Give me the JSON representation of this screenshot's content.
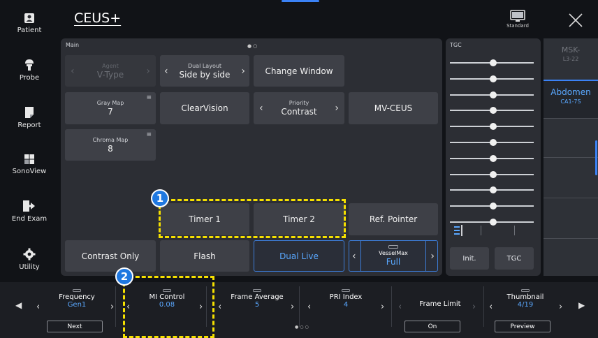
{
  "header": {
    "title": "CEUS+",
    "preset_label": "Standard"
  },
  "sidebar": {
    "items": [
      {
        "label": "Patient",
        "icon": "patient-icon"
      },
      {
        "label": "Probe",
        "icon": "probe-icon"
      },
      {
        "label": "Report",
        "icon": "report-icon"
      },
      {
        "label": "SonoView",
        "icon": "sonoview-icon"
      },
      {
        "label": "End Exam",
        "icon": "end-exam-icon"
      },
      {
        "label": "Utility",
        "icon": "gear-icon"
      }
    ]
  },
  "main": {
    "panel_label": "Main",
    "agent": {
      "small": "Agent",
      "value": "V-Type"
    },
    "dual_layout": {
      "small": "Dual Layout",
      "value": "Side by side"
    },
    "change_window": "Change Window",
    "gray_map": {
      "small": "Gray Map",
      "value": "7"
    },
    "clearvision": "ClearVision",
    "priority": {
      "small": "Priority",
      "value": "Contrast"
    },
    "mv_ceus": "MV-CEUS",
    "chroma_map": {
      "small": "Chroma Map",
      "value": "8"
    },
    "timer1": "Timer 1",
    "timer2": "Timer 2",
    "ref_pointer": "Ref. Pointer",
    "contrast_only": "Contrast Only",
    "flash": "Flash",
    "dual_live": "Dual Live",
    "vessel_max": {
      "small": "VesselMax",
      "value": "Full"
    }
  },
  "tgc": {
    "label": "TGC",
    "init_label": "Init.",
    "tgc_button_label": "TGC",
    "slider_count": 11
  },
  "probes": [
    {
      "name": "MSK-",
      "sub": "L3-22",
      "selected": false
    },
    {
      "name": "Abdomen",
      "sub": "CA1-7S",
      "selected": true
    }
  ],
  "bottom": {
    "frequency": {
      "label": "Frequency",
      "value": "Gen1",
      "button": "Next"
    },
    "mi_control": {
      "label": "MI Control",
      "value": "0.08"
    },
    "frame_average": {
      "label": "Frame Average",
      "value": "5"
    },
    "pri_index": {
      "label": "PRI Index",
      "value": "4"
    },
    "frame_limit": {
      "label": "Frame Limit",
      "button": "On"
    },
    "thumbnail": {
      "label": "Thumbnail",
      "value": "4/19",
      "button": "Preview"
    }
  },
  "annotations": {
    "callout1": "1",
    "callout2": "2"
  },
  "colors": {
    "accent": "#3b82f6",
    "highlight": "#f5e000",
    "value_blue": "#5aa8ff"
  }
}
